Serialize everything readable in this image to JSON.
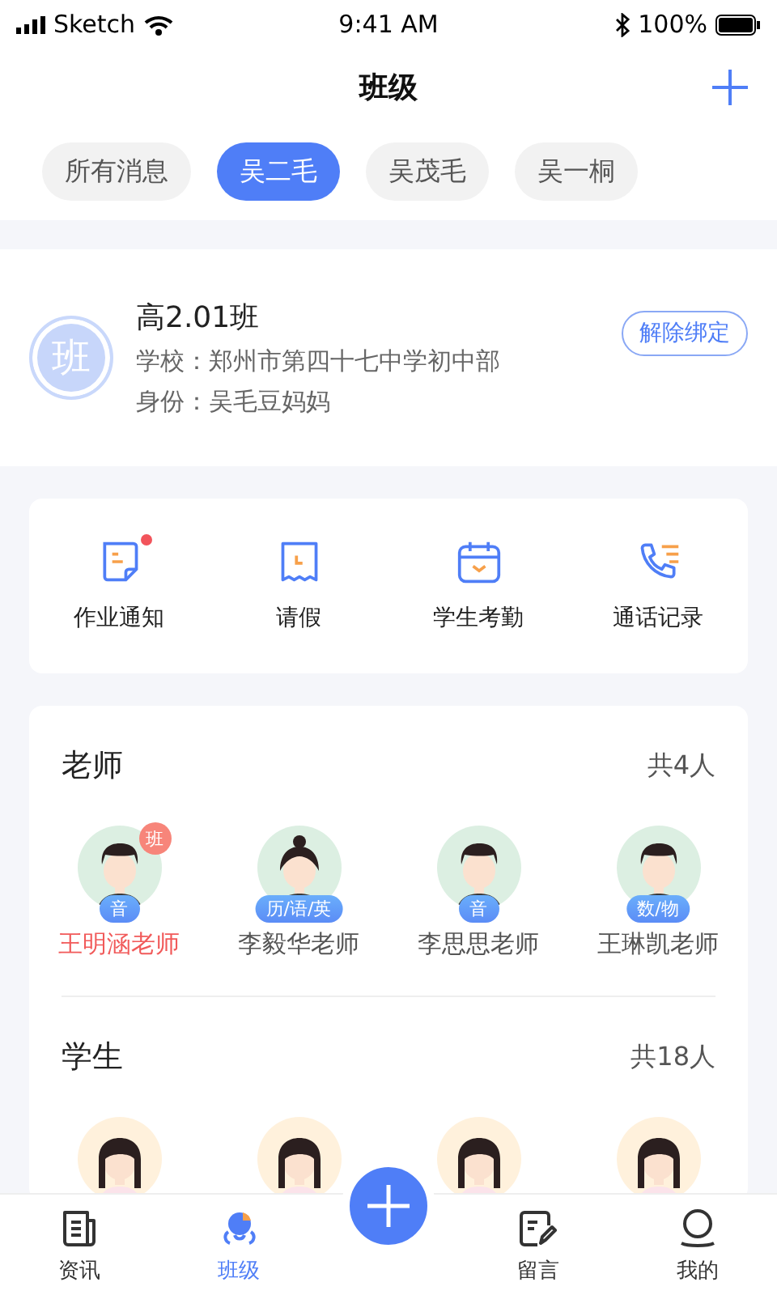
{
  "status_bar": {
    "carrier": "Sketch",
    "time": "9:41 AM",
    "battery": "100%"
  },
  "header": {
    "title": "班级"
  },
  "filter_tabs": [
    {
      "label": "所有消息",
      "selected": false
    },
    {
      "label": "吴二毛",
      "selected": true
    },
    {
      "label": "吴茂毛",
      "selected": false
    },
    {
      "label": "吴一桐",
      "selected": false
    }
  ],
  "class_card": {
    "avatar_text": "班",
    "name": "高2.01班",
    "school": "学校：郑州市第四十七中学初中部",
    "identity": "身份：吴毛豆妈妈",
    "unbind_button": "解除绑定"
  },
  "features": [
    {
      "label": "作业通知",
      "kind": "homework",
      "badge": true
    },
    {
      "label": "请假",
      "kind": "leave",
      "badge": false
    },
    {
      "label": "学生考勤",
      "kind": "attendance",
      "badge": false
    },
    {
      "label": "通话记录",
      "kind": "calls",
      "badge": false
    }
  ],
  "teachers": {
    "title": "老师",
    "count": "共4人",
    "members": [
      {
        "name": "王明涵老师",
        "kind": "male",
        "subject": "音",
        "badge": "班",
        "highlighted": true
      },
      {
        "name": "李毅华老师",
        "kind": "female_bun",
        "subject": "历/语/英",
        "highlighted": false
      },
      {
        "name": "李思思老师",
        "kind": "male",
        "subject": "音",
        "highlighted": false
      },
      {
        "name": "王琳凯老师",
        "kind": "male",
        "subject": "数/物",
        "highlighted": false
      }
    ]
  },
  "students": {
    "title": "学生",
    "count": "共18人",
    "members": [
      {
        "kind": "girl"
      },
      {
        "kind": "girl"
      },
      {
        "kind": "girl"
      },
      {
        "kind": "girl"
      }
    ]
  },
  "tab_bar": [
    {
      "label": "资讯",
      "kind": "news",
      "selected": false
    },
    {
      "label": "班级",
      "kind": "class",
      "selected": true
    },
    {
      "kind": "add"
    },
    {
      "label": "留言",
      "kind": "message",
      "selected": false
    },
    {
      "label": "我的",
      "kind": "profile",
      "selected": false
    }
  ]
}
